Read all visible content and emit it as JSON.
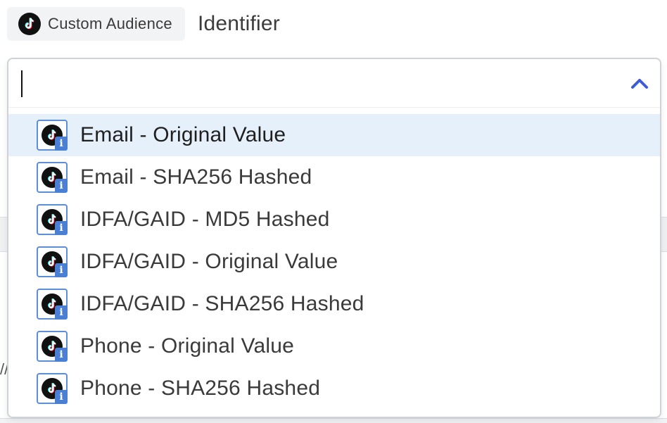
{
  "header": {
    "chip_label": "Custom Audience",
    "title": "Identifier"
  },
  "select": {
    "value": "",
    "expanded": true,
    "options": [
      {
        "label": "Email - Original Value",
        "icon": "tiktok-info-icon",
        "highlighted": true
      },
      {
        "label": "Email - SHA256 Hashed",
        "icon": "tiktok-info-icon",
        "highlighted": false
      },
      {
        "label": "IDFA/GAID - MD5 Hashed",
        "icon": "tiktok-info-icon",
        "highlighted": false
      },
      {
        "label": "IDFA/GAID - Original Value",
        "icon": "tiktok-info-icon",
        "highlighted": false
      },
      {
        "label": "IDFA/GAID - SHA256 Hashed",
        "icon": "tiktok-info-icon",
        "highlighted": false
      },
      {
        "label": "Phone - Original Value",
        "icon": "tiktok-info-icon",
        "highlighted": false
      },
      {
        "label": "Phone - SHA256 Hashed",
        "icon": "tiktok-info-icon",
        "highlighted": false
      }
    ],
    "info_badge": "i"
  },
  "background": {
    "edge_text": "//"
  },
  "colors": {
    "accent": "#3b5bdb",
    "highlight_row": "#e6f0fb",
    "icon_border": "#5b8fd9",
    "info_badge": "#4a7fd4"
  }
}
